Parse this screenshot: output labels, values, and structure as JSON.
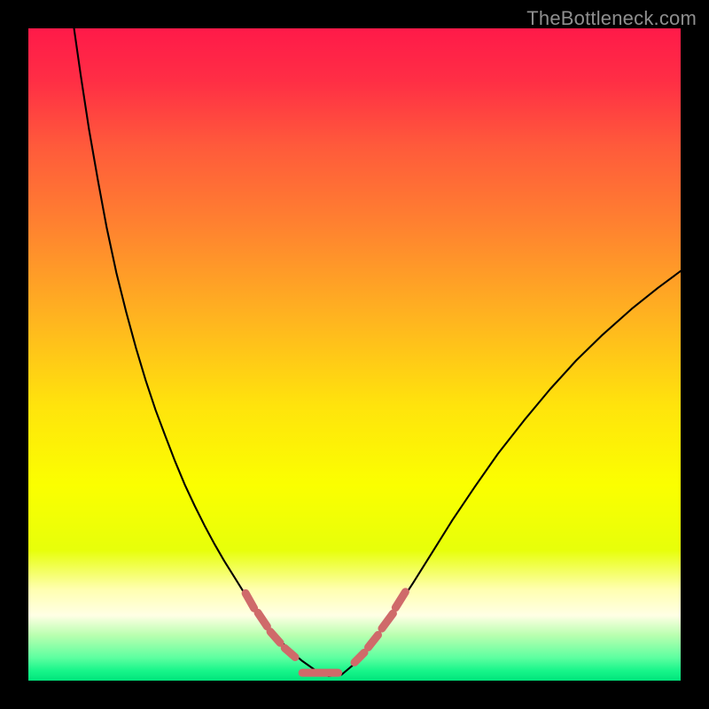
{
  "attribution": "TheBottleneck.com",
  "chart_data": {
    "type": "line",
    "title": "",
    "xlabel": "",
    "ylabel": "",
    "xlim": [
      0,
      100
    ],
    "ylim": [
      0,
      100
    ],
    "grid": false,
    "legend": false,
    "background": {
      "type": "vertical-gradient",
      "stops": [
        {
          "offset": 0.0,
          "color": "#ff1a49"
        },
        {
          "offset": 0.08,
          "color": "#ff2e45"
        },
        {
          "offset": 0.18,
          "color": "#ff5a3b"
        },
        {
          "offset": 0.3,
          "color": "#ff8130"
        },
        {
          "offset": 0.45,
          "color": "#ffb61f"
        },
        {
          "offset": 0.58,
          "color": "#ffe40c"
        },
        {
          "offset": 0.7,
          "color": "#fbff00"
        },
        {
          "offset": 0.8,
          "color": "#e7ff0a"
        },
        {
          "offset": 0.86,
          "color": "#ffffb0"
        },
        {
          "offset": 0.9,
          "color": "#ffffe5"
        },
        {
          "offset": 0.93,
          "color": "#baffb0"
        },
        {
          "offset": 0.965,
          "color": "#5dffa0"
        },
        {
          "offset": 0.985,
          "color": "#17f58a"
        },
        {
          "offset": 1.0,
          "color": "#00e47b"
        }
      ]
    },
    "series": [
      {
        "name": "curve",
        "stroke": "#000000",
        "stroke_width": 2.1,
        "x": [
          7.0,
          8.0,
          9.3,
          10.7,
          12.0,
          13.5,
          15.0,
          16.5,
          18.0,
          19.5,
          21.0,
          22.5,
          24.0,
          25.5,
          27.0,
          28.5,
          30.0,
          31.5,
          33.0,
          34.5,
          36.0,
          38.0,
          40.0,
          42.0,
          44.0,
          46.0,
          48.0,
          50.5,
          53.0,
          56.0,
          59.0,
          62.0,
          65.0,
          68.5,
          72.0,
          76.0,
          80.0,
          84.0,
          88.0,
          92.5,
          96.5,
          100.0
        ],
        "y": [
          100.0,
          93.0,
          84.5,
          76.5,
          69.5,
          62.5,
          56.5,
          51.0,
          46.0,
          41.5,
          37.5,
          33.6,
          30.0,
          26.8,
          23.8,
          21.0,
          18.4,
          16.0,
          13.6,
          11.3,
          9.2,
          6.8,
          4.7,
          3.0,
          1.6,
          0.7,
          0.9,
          3.0,
          6.2,
          10.4,
          15.0,
          19.8,
          24.6,
          29.8,
          34.8,
          39.9,
          44.7,
          49.1,
          53.0,
          57.0,
          60.2,
          62.8
        ]
      },
      {
        "name": "bottom-markers",
        "stroke": "#cf6a6a",
        "stroke_width": 9,
        "type": "segments",
        "segments": [
          {
            "x1": 33.3,
            "y1": 13.4,
            "x2": 34.6,
            "y2": 11.1
          },
          {
            "x1": 35.2,
            "y1": 10.4,
            "x2": 36.6,
            "y2": 8.3
          },
          {
            "x1": 37.1,
            "y1": 7.5,
            "x2": 38.6,
            "y2": 5.8
          },
          {
            "x1": 39.3,
            "y1": 5.0,
            "x2": 40.9,
            "y2": 3.6
          },
          {
            "x1": 42.0,
            "y1": 1.2,
            "x2": 47.5,
            "y2": 1.2
          },
          {
            "x1": 50.0,
            "y1": 2.8,
            "x2": 51.5,
            "y2": 4.3
          },
          {
            "x1": 52.1,
            "y1": 5.1,
            "x2": 53.6,
            "y2": 7.0
          },
          {
            "x1": 54.2,
            "y1": 8.0,
            "x2": 55.9,
            "y2": 10.3
          },
          {
            "x1": 56.3,
            "y1": 11.2,
            "x2": 57.8,
            "y2": 13.6
          }
        ]
      }
    ]
  }
}
